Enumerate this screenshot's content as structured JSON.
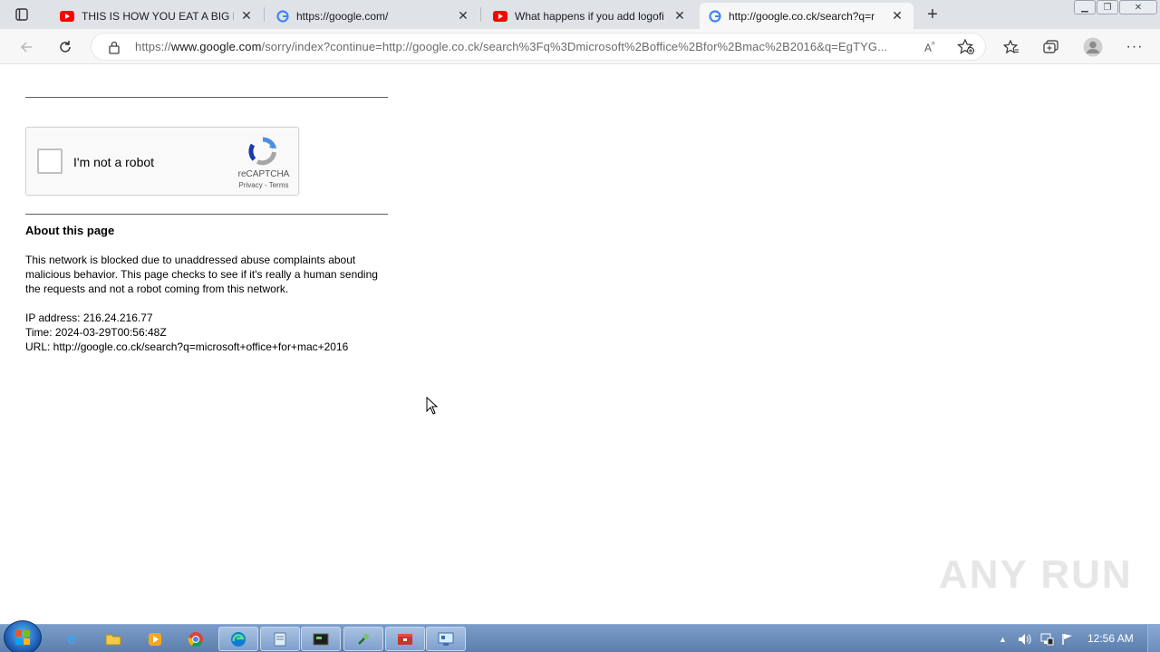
{
  "tabs": [
    {
      "title": "THIS IS HOW YOU EAT A BIG M",
      "favicon": "youtube-icon"
    },
    {
      "title": "https://google.com/",
      "favicon": "google-icon"
    },
    {
      "title": "What happens if you add logofi",
      "favicon": "youtube-icon"
    },
    {
      "title": "http://google.co.ck/search?q=r",
      "favicon": "google-icon",
      "active": true
    }
  ],
  "address": {
    "prefix": "https://",
    "host": "www.google.com",
    "path": "/sorry/index?continue=http://google.co.ck/search%3Fq%3Dmicrosoft%2Boffice%2Bfor%2Bmac%2B2016&q=EgTYG..."
  },
  "captcha": {
    "checkbox_label": "I'm not a robot",
    "brand": "reCAPTCHA",
    "privacy": "Privacy",
    "separator": " - ",
    "terms": "Terms"
  },
  "about": {
    "title": "About this page",
    "body": "This network is blocked due to unaddressed abuse complaints about malicious behavior. This page checks to see if it's really a human sending the requests and not a robot coming from this network.",
    "ip": "IP address: 216.24.216.77",
    "time": "Time: 2024-03-29T00:56:48Z",
    "url": "URL: http://google.co.ck/search?q=microsoft+office+for+mac+2016"
  },
  "watermark": "ANY RUN",
  "taskbar": {
    "clock": "12:56 AM",
    "apps": [
      "internet-explorer-icon",
      "folder-icon",
      "media-player-icon",
      "chrome-icon",
      "edge-icon",
      "notepad-icon",
      "terminal-icon",
      "tool-icon",
      "archive-icon",
      "network-monitor-icon"
    ]
  },
  "colors": {
    "accent": "#1a73e8",
    "tabstrip": "#dfe3e8",
    "taskbar": "#6b8dbd"
  }
}
